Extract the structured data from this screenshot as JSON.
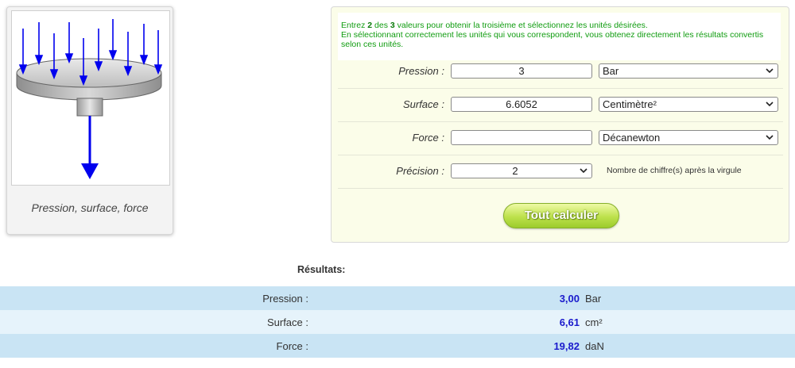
{
  "illustration": {
    "caption": "Pression, surface, force"
  },
  "form": {
    "intro": {
      "part1": "Entrez ",
      "bold1": "2",
      "part2": " des ",
      "bold2": "3",
      "part3": " valeurs pour obtenir la troisième et sélectionnez les unités désirées.",
      "line2": "En sélectionnant correctement les unités qui vous correspondent, vous obtenez directement les résultats convertis selon ces unités."
    },
    "pression": {
      "label": "Pression :",
      "value": "3",
      "unit": "Bar"
    },
    "surface": {
      "label": "Surface :",
      "value": "6.6052",
      "unit": "Centimètre²"
    },
    "force": {
      "label": "Force :",
      "value": "",
      "unit": "Décanewton"
    },
    "precision": {
      "label": "Précision :",
      "value": "2",
      "note": "Nombre de chiffre(s) après la virgule"
    },
    "calc_label": "Tout calculer"
  },
  "results": {
    "title": "Résultats:",
    "rows": [
      {
        "label": "Pression :",
        "value": "3,00",
        "unit": "Bar"
      },
      {
        "label": "Surface :",
        "value": "6,61",
        "unit": "cm²"
      },
      {
        "label": "Force :",
        "value": "19,82",
        "unit": "daN"
      }
    ]
  },
  "colors": {
    "intro_text": "#109c10",
    "panel_bg": "#fbfde9",
    "result_value": "#1a1acc",
    "result_row_dark": "#c9e4f4",
    "result_row_light": "#e6f3fb",
    "button_green": "#bde14c",
    "arrow_blue": "#0000ee"
  }
}
